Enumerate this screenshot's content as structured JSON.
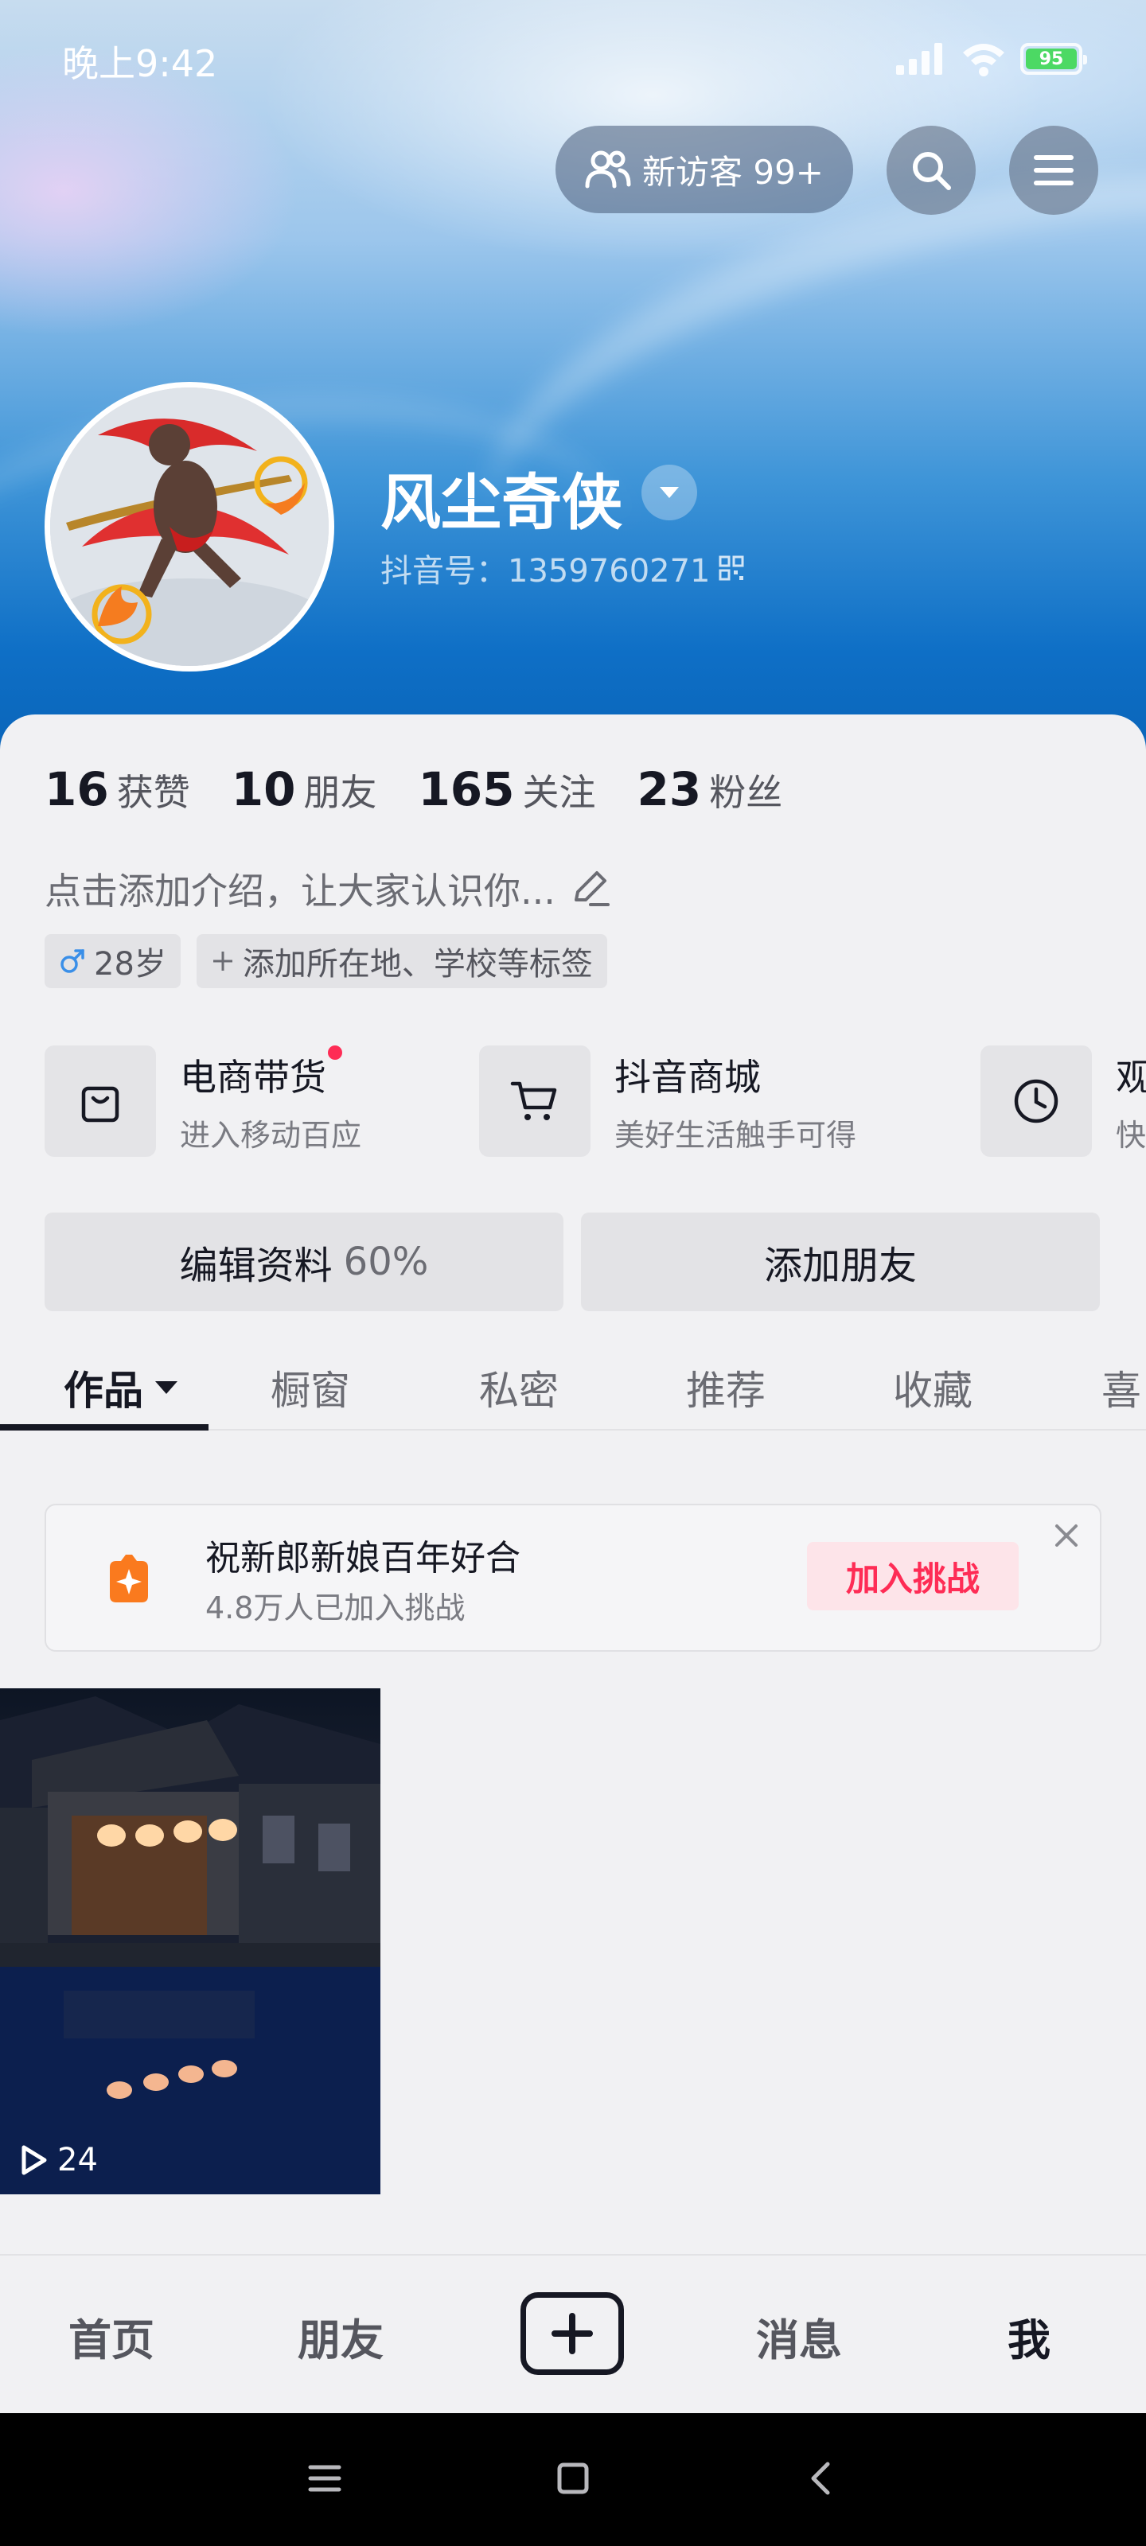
{
  "status_bar": {
    "time": "晚上9:42",
    "battery": "95"
  },
  "header": {
    "visitor_label": "新访客 99+"
  },
  "profile": {
    "username": "风尘奇侠",
    "douyin_id": "抖音号：1359760271"
  },
  "stats": [
    {
      "value": "16",
      "label": "获赞"
    },
    {
      "value": "10",
      "label": "朋友"
    },
    {
      "value": "165",
      "label": "关注"
    },
    {
      "value": "23",
      "label": "粉丝"
    }
  ],
  "bio_placeholder": "点击添加介绍，让大家认识你...",
  "tags": {
    "age": "28岁",
    "add": "添加所在地、学校等标签"
  },
  "services": [
    {
      "title": "电商带货",
      "subtitle": "进入移动百应"
    },
    {
      "title": "抖音商城",
      "subtitle": "美好生活触手可得"
    },
    {
      "title": "观",
      "subtitle": "快"
    }
  ],
  "actions": {
    "edit_profile": "编辑资料",
    "edit_percent": "60%",
    "add_friend": "添加朋友"
  },
  "tabs": [
    "作品",
    "橱窗",
    "私密",
    "推荐",
    "收藏",
    "喜"
  ],
  "challenge": {
    "title": "祝新郎新娘百年好合",
    "subtitle": "4.8万人已加入挑战",
    "join_label": "加入挑战"
  },
  "video": {
    "play_count": "24"
  },
  "bottom_nav": [
    "首页",
    "朋友",
    "消息",
    "我"
  ],
  "colors": {
    "accent": "#fe2c55",
    "hero_blue": "#0e6fc6",
    "text_primary": "#161823"
  },
  "icons": [
    "signal-icon",
    "wifi-icon",
    "battery-icon",
    "visitors-icon",
    "search-icon",
    "menu-icon",
    "caret-down-icon",
    "qr-code-icon",
    "edit-pencil-icon",
    "male-icon",
    "plus-icon",
    "shopping-bag-icon",
    "cart-icon",
    "clock-icon",
    "flame-icon",
    "close-icon",
    "play-icon"
  ]
}
